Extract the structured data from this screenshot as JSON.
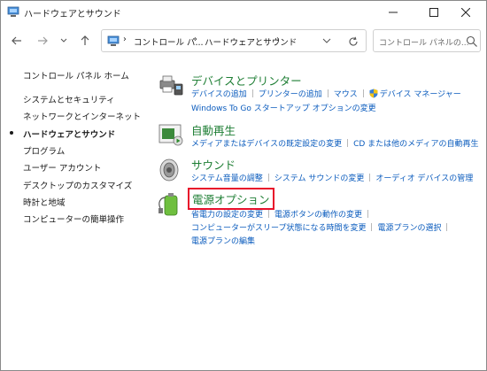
{
  "window": {
    "title": "ハードウェアとサウンド"
  },
  "address": {
    "crumbs": [
      "コントロール パ...",
      "ハードウェアとサウンド"
    ],
    "search_placeholder": "コントロール パネルの..."
  },
  "leftnav": {
    "home": "コントロール パネル ホーム",
    "items": [
      "システムとセキュリティ",
      "ネットワークとインターネット",
      "ハードウェアとサウンド",
      "プログラム",
      "ユーザー アカウント",
      "デスクトップのカスタマイズ",
      "時計と地域",
      "コンピューターの簡単操作"
    ],
    "current_index": 2
  },
  "categories": {
    "devices": {
      "title": "デバイスとプリンター",
      "links_row1": [
        "デバイスの追加",
        "プリンターの追加",
        "マウス",
        "デバイス マネージャー"
      ],
      "links_row2": [
        "Windows To Go スタートアップ オプションの変更"
      ]
    },
    "autoplay": {
      "title": "自動再生",
      "links_row1": [
        "メディアまたはデバイスの既定設定の変更",
        "CD または他のメディアの自動再生"
      ]
    },
    "sound": {
      "title": "サウンド",
      "links_row1": [
        "システム音量の調整",
        "システム サウンドの変更",
        "オーディオ デバイスの管理"
      ]
    },
    "power": {
      "title": "電源オプション",
      "links_row1": [
        "省電力の設定の変更",
        "電源ボタンの動作の変更"
      ],
      "links_row2": [
        "コンピューターがスリープ状態になる時間を変更",
        "電源プランの選択"
      ],
      "links_row3": [
        "電源プランの編集"
      ]
    }
  },
  "colors": {
    "link": "#0a5bbd",
    "category_title": "#1e7e34",
    "highlight_box": "#e8102a"
  }
}
